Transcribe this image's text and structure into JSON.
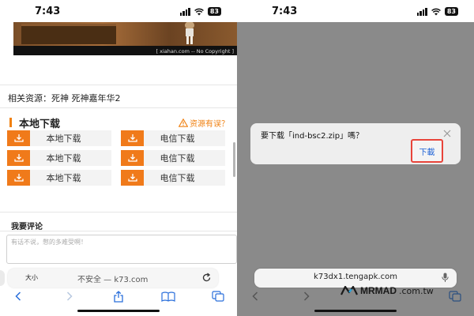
{
  "left": {
    "status": {
      "time": "7:43",
      "battery": "83"
    },
    "video": {
      "caption": "[ xiahan.com -- No Copyright ]"
    },
    "resources_text": "相关资源：死神 死神嘉年华2",
    "download_section": {
      "title": "本地下载",
      "report_label": "资源有误？",
      "rows": [
        {
          "left": "本地下载",
          "right": "电信下载"
        },
        {
          "left": "本地下载",
          "right": "电信下载"
        },
        {
          "left": "本地下载",
          "right": "电信下载"
        }
      ]
    },
    "comment": {
      "title": "我要评论",
      "placeholder": "有话不说，憋的多难受啊！"
    },
    "address_bar": {
      "text_size": "大小",
      "url": "不安全 — k73.com"
    }
  },
  "right": {
    "status": {
      "time": "7:43",
      "battery": "83"
    },
    "dialog": {
      "message": "要下载「ind-bsc2.zip」嗎？",
      "download_label": "下載"
    },
    "address_bar": {
      "url": "k73dx1.tengapk.com"
    },
    "watermark": {
      "brand": "MRMAD",
      "tld": ".com.tw"
    }
  },
  "colors": {
    "accent": "#f07a1a",
    "highlight": "#e8443a",
    "link": "#1e62d6"
  }
}
